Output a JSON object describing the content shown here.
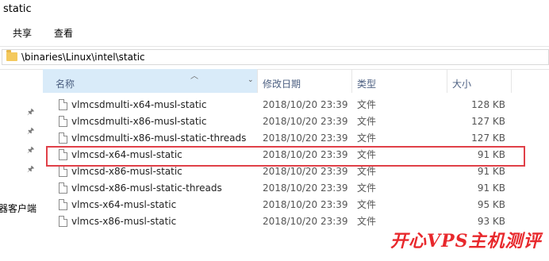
{
  "window": {
    "title": "static"
  },
  "ribbon": {
    "tabs": [
      "共享",
      "查看"
    ]
  },
  "address": {
    "path": "\\binaries\\Linux\\intel\\static"
  },
  "left_pane": {
    "clipped_label": "器客户端"
  },
  "columns": {
    "name": "名称",
    "date": "修改日期",
    "type": "类型",
    "size": "大小"
  },
  "files": [
    {
      "name": "vlmcsdmulti-x64-musl-static",
      "date": "2018/10/20 23:39",
      "type": "文件",
      "size": "128 KB"
    },
    {
      "name": "vlmcsdmulti-x86-musl-static",
      "date": "2018/10/20 23:39",
      "type": "文件",
      "size": "127 KB"
    },
    {
      "name": "vlmcsdmulti-x86-musl-static-threads",
      "date": "2018/10/20 23:39",
      "type": "文件",
      "size": "127 KB"
    },
    {
      "name": "vlmcsd-x64-musl-static",
      "date": "2018/10/20 23:39",
      "type": "文件",
      "size": "91 KB"
    },
    {
      "name": "vlmcsd-x86-musl-static",
      "date": "2018/10/20 23:39",
      "type": "文件",
      "size": "91 KB"
    },
    {
      "name": "vlmcsd-x86-musl-static-threads",
      "date": "2018/10/20 23:39",
      "type": "文件",
      "size": "91 KB"
    },
    {
      "name": "vlmcs-x64-musl-static",
      "date": "2018/10/20 23:39",
      "type": "文件",
      "size": "95 KB"
    },
    {
      "name": "vlmcs-x86-musl-static",
      "date": "2018/10/20 23:39",
      "type": "文件",
      "size": "93 KB"
    }
  ],
  "watermark": "开心VPS主机测评",
  "colors": {
    "highlight": "#e04048",
    "header_selected": "#d9ebf9",
    "watermark": "#e8282c"
  }
}
